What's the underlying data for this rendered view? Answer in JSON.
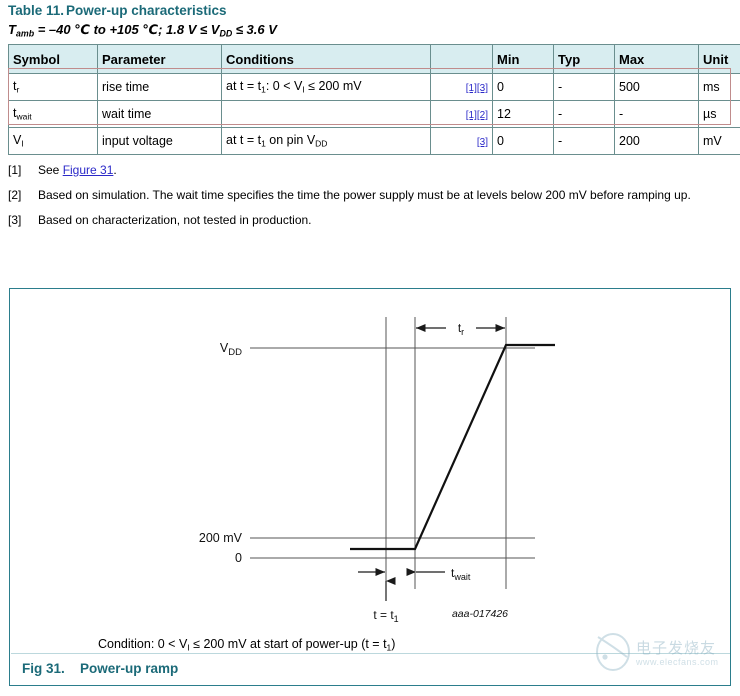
{
  "table": {
    "number": "Table 11.",
    "title": "Power-up characteristics",
    "conditions_line": "Tamb = –40 ℃ to +105 ℃; 1.8 V ≤ VDD ≤ 3.6 V",
    "headers": [
      "Symbol",
      "Parameter",
      "Conditions",
      "",
      "Min",
      "Typ",
      "Max",
      "Unit"
    ],
    "rows": [
      {
        "symbol": "tr",
        "symbol_base": "t",
        "symbol_sub": "r",
        "parameter": "rise time",
        "conditions": "at t = t1: 0 < VI ≤ 200 mV",
        "notes": [
          "[1]",
          "[3]"
        ],
        "min": "0",
        "typ": "-",
        "max": "500",
        "unit": "ms",
        "highlighted": true
      },
      {
        "symbol": "twait",
        "symbol_base": "t",
        "symbol_sub": "wait",
        "parameter": "wait time",
        "conditions": "",
        "notes": [
          "[1]",
          "[2]"
        ],
        "min": "12",
        "typ": "-",
        "max": "-",
        "unit": "µs",
        "highlighted": true
      },
      {
        "symbol": "VI",
        "symbol_base": "V",
        "symbol_sub": "I",
        "parameter": "input voltage",
        "conditions": "at t = t1 on pin VDD",
        "notes": [
          "[3]"
        ],
        "min": "0",
        "typ": "-",
        "max": "200",
        "unit": "mV",
        "highlighted": false
      }
    ]
  },
  "footnotes": [
    {
      "mark": "[1]",
      "text_before": "See ",
      "link": "Figure 31",
      "text_after": "."
    },
    {
      "mark": "[2]",
      "text_before": "Based on simulation. The wait time specifies the time the power supply must be at levels below 200 mV before ramping up.",
      "link": "",
      "text_after": ""
    },
    {
      "mark": "[3]",
      "text_before": "Based on characterization, not tested in production.",
      "link": "",
      "text_after": ""
    }
  ],
  "figure": {
    "number": "Fig 31.",
    "caption": "Power-up ramp",
    "condition": "Condition: 0 < VI ≤ 200 mV at start of power-up (t = t1)",
    "drawing_id": "aaa-017426",
    "axis_labels": {
      "vdd": "VDD",
      "vdd_base": "V",
      "vdd_sub": "DD",
      "level_200mv": "200 mV",
      "level_zero": "0"
    },
    "annotations": {
      "rise_time": "tr",
      "rise_time_base": "t",
      "rise_time_sub": "r",
      "wait_time": "twait",
      "wait_time_base": "t",
      "wait_time_sub": "wait",
      "t_equals_t1": "t = t1"
    }
  },
  "watermark": {
    "text_cn": "电子发烧友",
    "url": "www.elecfans.com"
  },
  "colors": {
    "title_teal": "#1b6a78",
    "header_bg": "#d8edf0",
    "border": "#6a8e8e",
    "link_blue": "#2b29c8",
    "highlight_border": "#c08c8c",
    "figure_border": "#2b7d8c"
  }
}
